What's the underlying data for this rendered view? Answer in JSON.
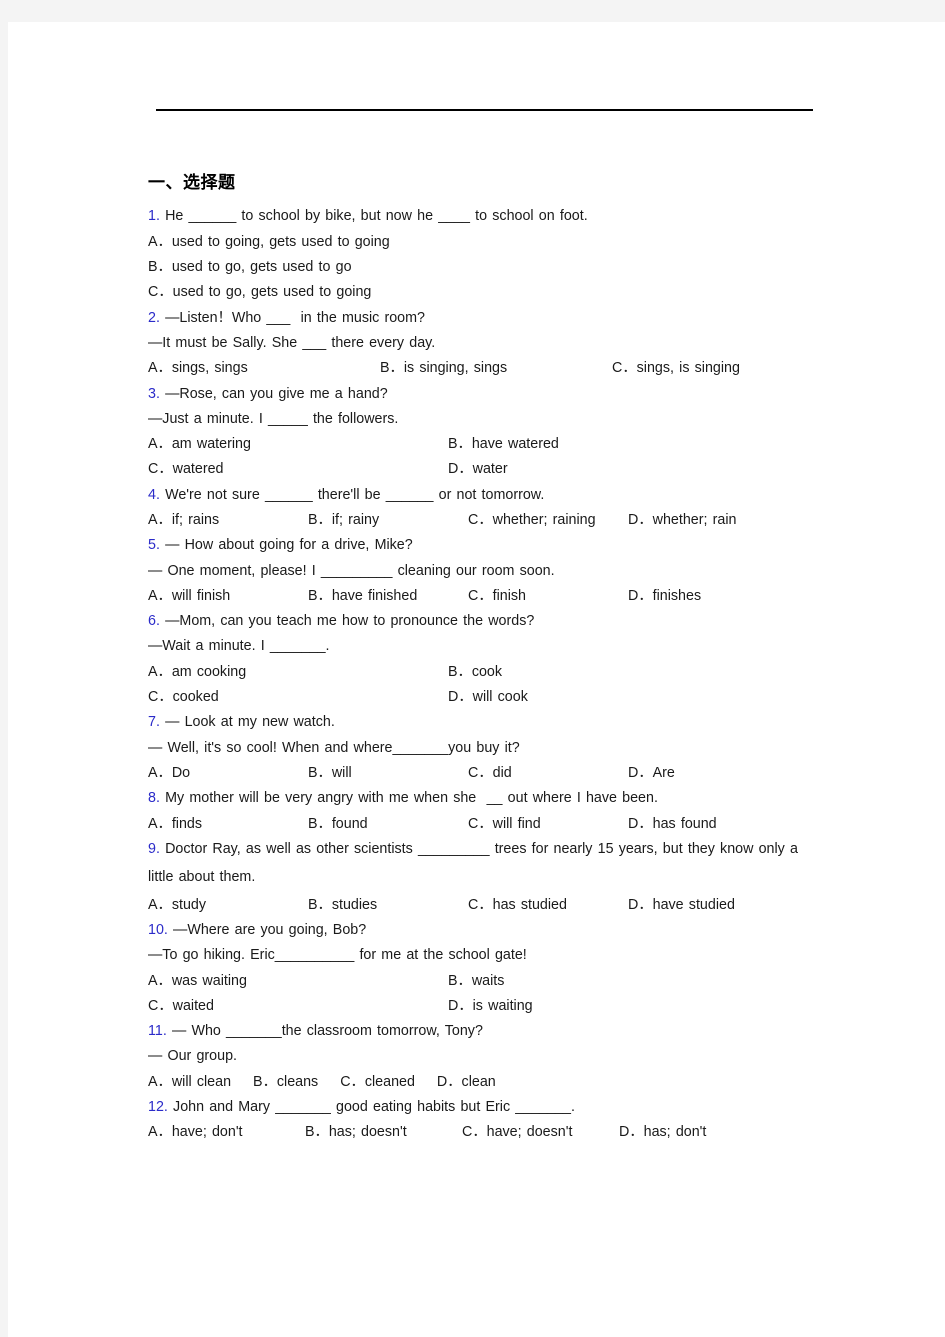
{
  "document": {
    "section_heading": "一、选择题",
    "accent_color": "#2b2bc9",
    "rule_color": "#000000",
    "page_background": "#ffffff",
    "canvas_background": "#f4f4f4"
  },
  "questions": [
    {
      "num": "1.",
      "stem": " He ______ to school by bike, but now he ____ to school on foot.",
      "options": [
        "A．used to going, gets used to going",
        "B．used to go, gets used to go",
        "C．used to go, gets used to going"
      ],
      "layout": "stacked"
    },
    {
      "num": "2.",
      "stem": " —Listen！Who ___  in the music room?",
      "stem2": "—It must be Sally. She ___ there every day.",
      "options": [
        "A．sings, sings",
        "B．is singing, sings",
        "C．sings, is singing"
      ],
      "layout": "row3"
    },
    {
      "num": "3.",
      "stem": " —Rose, can you give me a hand?",
      "stem2": "—Just a minute. I _____ the followers.",
      "options": [
        "A．am watering",
        "B．have watered",
        "C．watered",
        "D．water"
      ],
      "layout": "grid2"
    },
    {
      "num": "4.",
      "stem": " We're not sure ______ there'll be ______ or not tomorrow.",
      "options": [
        "A．if; rains",
        "B．if; rainy",
        "C．whether; raining",
        "D．whether; rain"
      ],
      "layout": "row4"
    },
    {
      "num": "5.",
      "stem": " — How about going for a drive, Mike?",
      "stem2": "— One moment, please! I _________ cleaning our room soon.",
      "options": [
        "A．will finish",
        "B．have finished",
        "C．finish",
        "D．finishes"
      ],
      "layout": "row4"
    },
    {
      "num": "6.",
      "stem": " —Mom, can you teach me how to pronounce the words?",
      "stem2": "—Wait a minute. I _______.",
      "options": [
        "A．am cooking",
        "B．cook",
        "C．cooked",
        "D．will cook"
      ],
      "layout": "grid2"
    },
    {
      "num": "7.",
      "stem": " — Look at my new watch.",
      "stem2": "— Well, it's so cool! When and where_______you buy it?",
      "options": [
        "A．Do",
        "B．will",
        "C．did",
        "D．Are"
      ],
      "layout": "row4"
    },
    {
      "num": "8.",
      "stem": " My mother will be very angry with me when she  __ out where I have been.",
      "options": [
        "A．finds",
        "B．found",
        "C．will find",
        "D．has found"
      ],
      "layout": "row4"
    },
    {
      "num": "9.",
      "stem": " Doctor Ray, as well as other scientists _________ trees for nearly 15 years, but they know only a little about them.",
      "options": [
        "A．study",
        "B．studies",
        "C．has studied",
        "D．have studied"
      ],
      "layout": "row4"
    },
    {
      "num": "10.",
      "stem": " —Where are you going, Bob?",
      "stem2": "—To go hiking. Eric__________ for me at the school gate!",
      "options": [
        "A．was waiting",
        "B．waits",
        "C．waited",
        "D．is waiting"
      ],
      "layout": "grid2"
    },
    {
      "num": "11.",
      "stem": " — Who _______the classroom tomorrow, Tony?",
      "stem2": "— Our group.",
      "options": [
        "A．will clean",
        "B．cleans",
        "C．cleaned",
        "D．clean"
      ],
      "layout": "tight"
    },
    {
      "num": "12.",
      "stem": " John and Mary _______ good eating habits but Eric _______.",
      "options": [
        "A．have; don't",
        "B．has; doesn't",
        "C．have; doesn't",
        "D．has; don't"
      ],
      "layout": "row4"
    }
  ]
}
